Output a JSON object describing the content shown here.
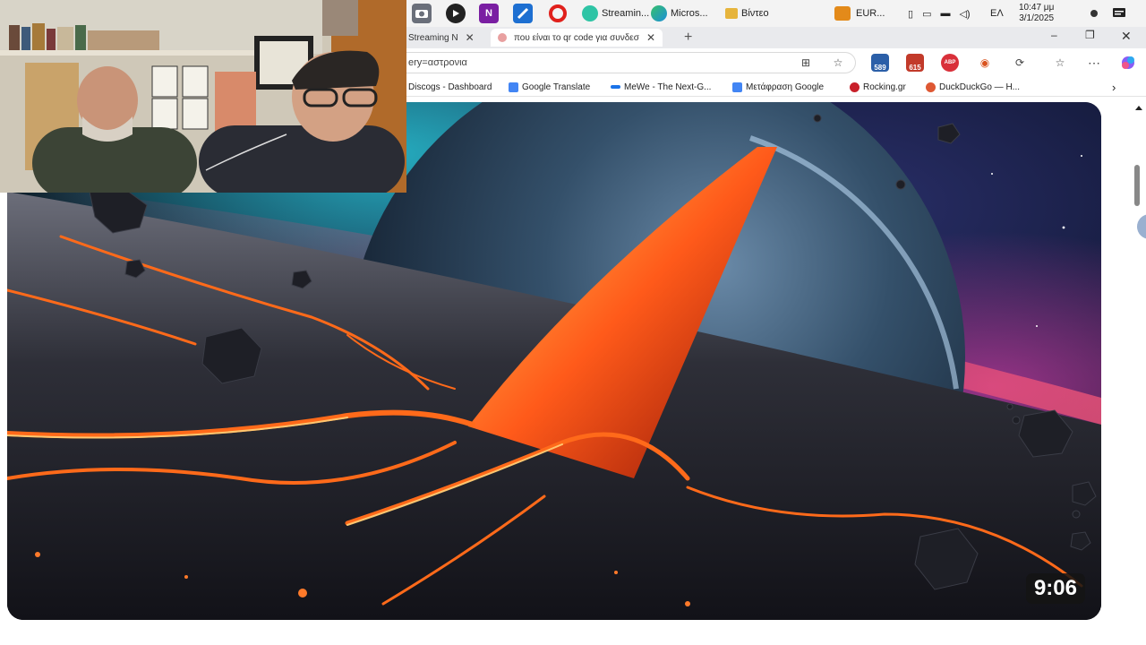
{
  "taskbar": {
    "apps": [
      {
        "label": "Streamin...",
        "icon": "streaming-app-icon",
        "color": "#2ec4a5"
      },
      {
        "label": "Micros...",
        "icon": "edge-browser-icon",
        "color": "#1b8fd8"
      },
      {
        "label": "Βίντεο",
        "icon": "video-folder-icon",
        "color": "#e6b43c"
      }
    ],
    "tray": {
      "currency": "EUR...",
      "language": "ΕΛ",
      "time": "10:47 μμ",
      "date": "3/1/2025"
    }
  },
  "browser": {
    "tabs": [
      {
        "label": "Streaming N"
      },
      {
        "label": "που είναι το qr code για συνδεσ"
      }
    ],
    "address": "ery=αστρονια",
    "extensions": [
      {
        "badge": "589",
        "color": "#2b5fa8"
      },
      {
        "badge": "615",
        "color": "#c23a2a"
      },
      {
        "badge": "ABP",
        "color": "#d9303a"
      }
    ],
    "favorites": [
      {
        "label": "Discogs - Dashboard",
        "color": "#333333"
      },
      {
        "label": "Google Translate",
        "color": "#4285f4"
      },
      {
        "label": "MeWe - The Next-G...",
        "color": "#1a73e8"
      },
      {
        "label": "Μετάφραση Google",
        "color": "#4285f4"
      },
      {
        "label": "Rocking.gr",
        "color": "#c8202a"
      },
      {
        "label": "DuckDuckGo — H...",
        "color": "#de5833"
      }
    ]
  },
  "video": {
    "duration": "9:06"
  }
}
